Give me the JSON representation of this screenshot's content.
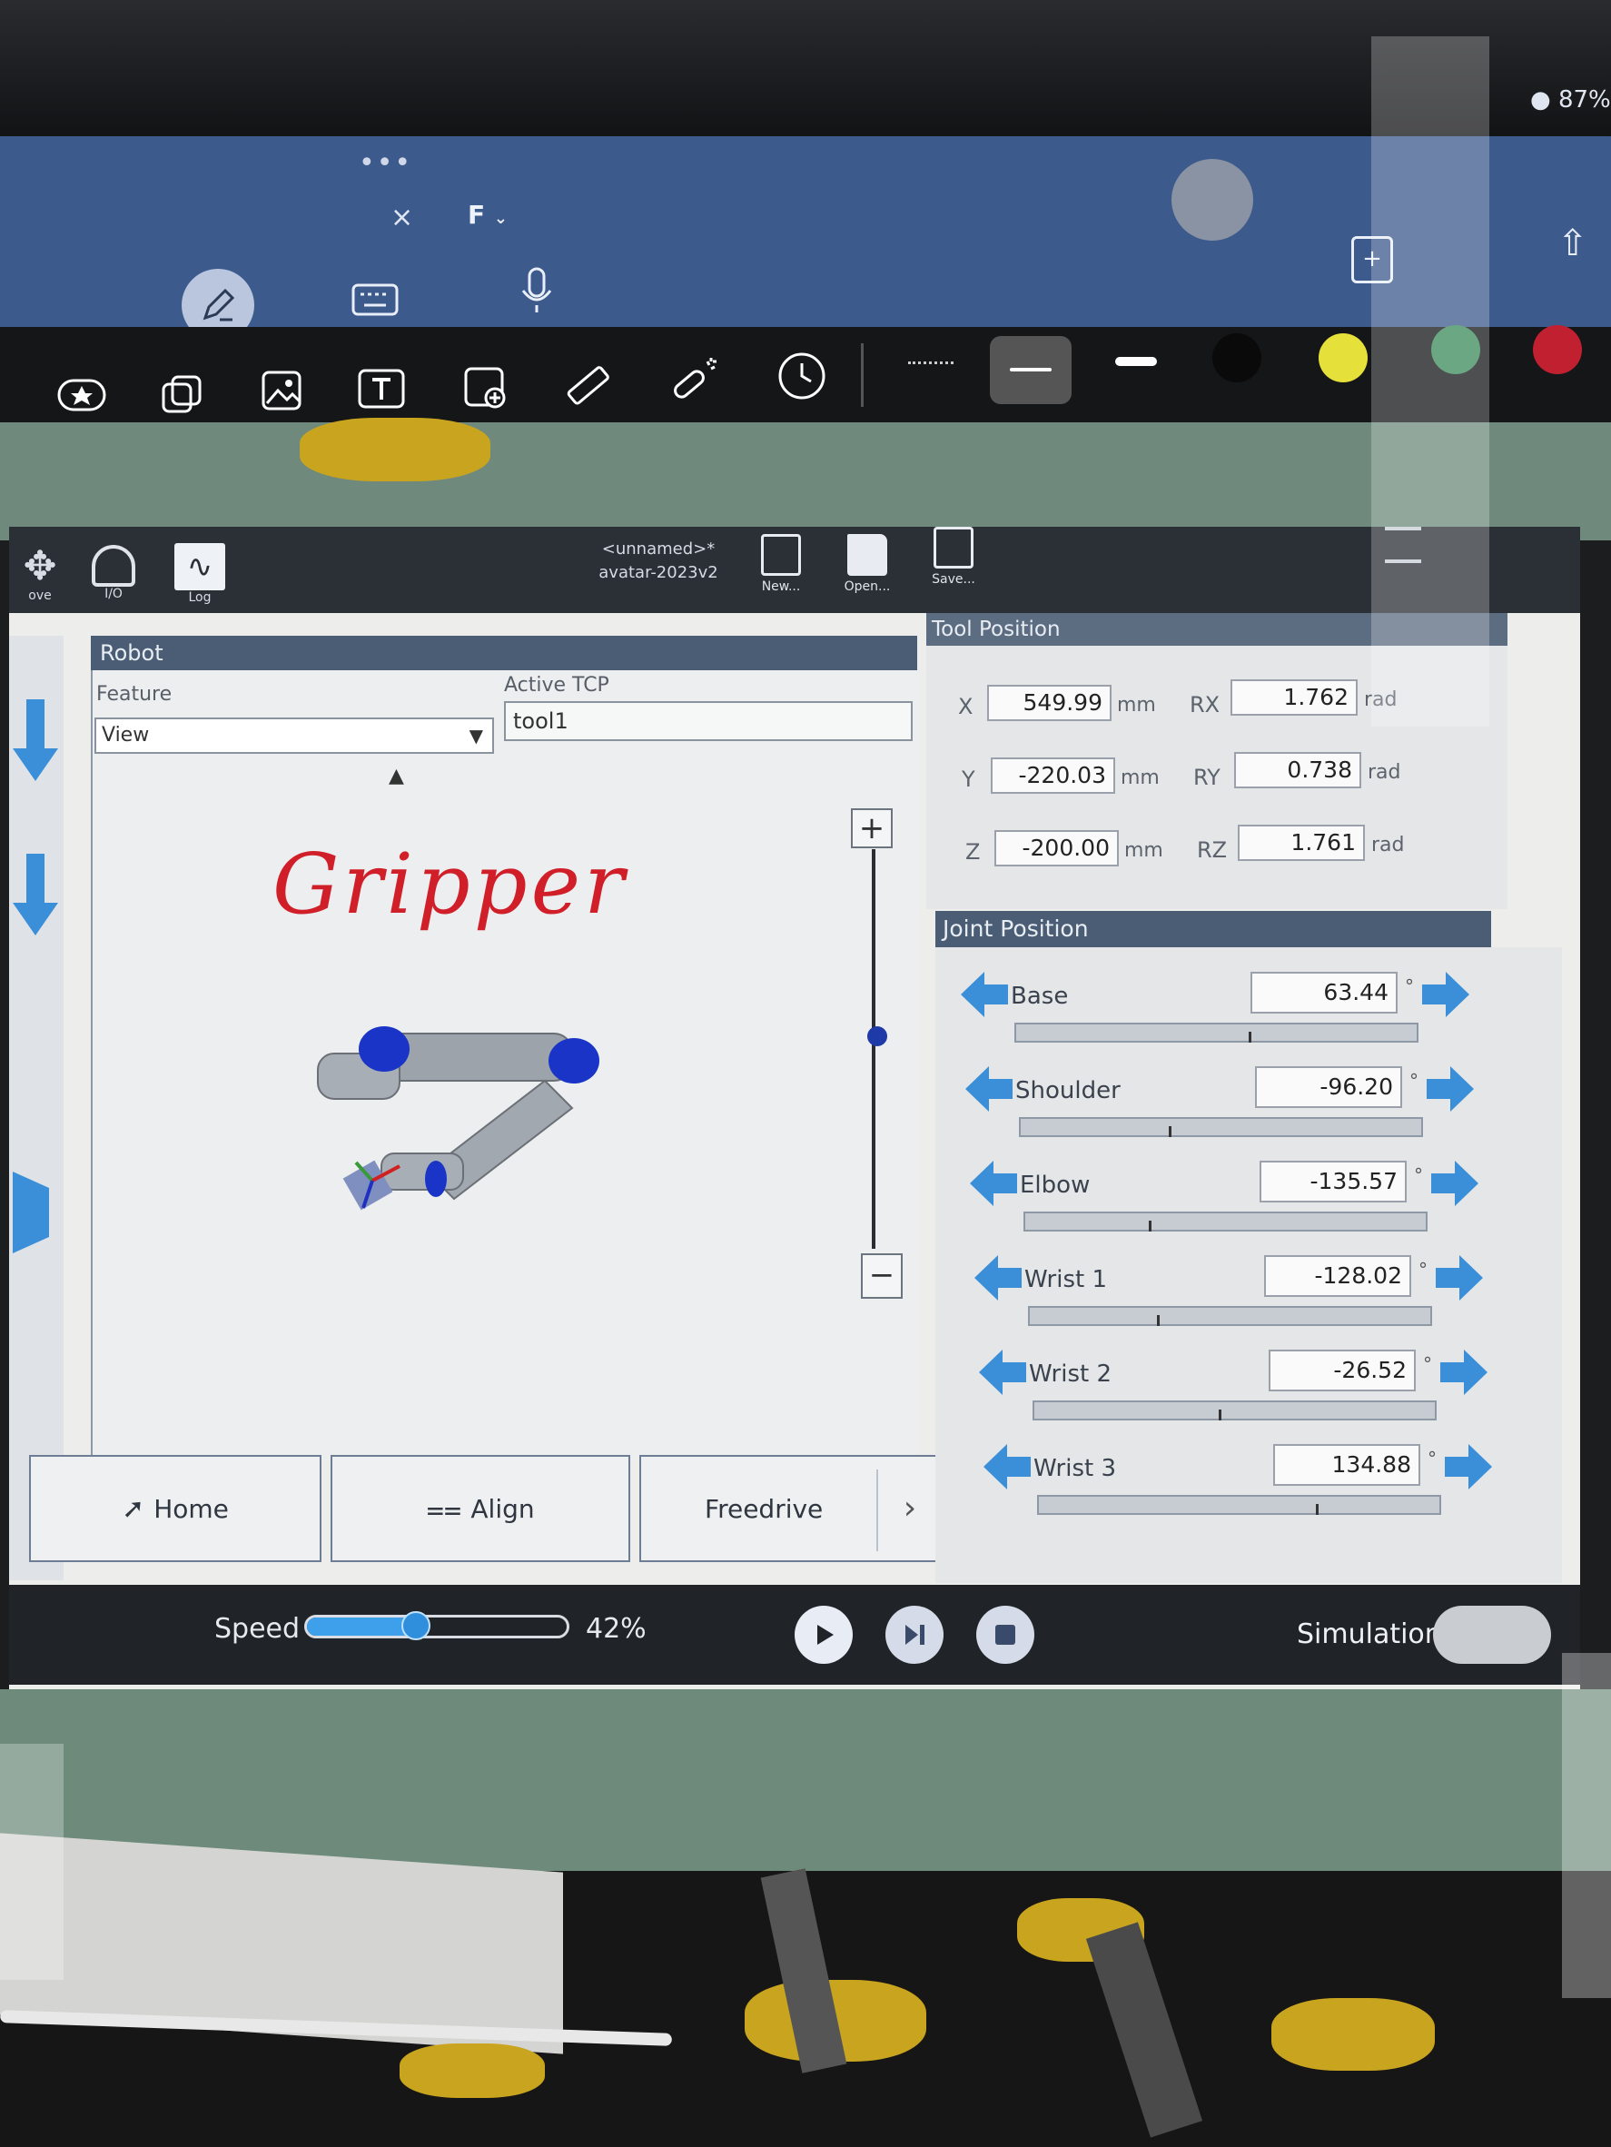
{
  "ipad": {
    "dots": "•••",
    "close": "×",
    "folder": "F",
    "battery": "87%"
  },
  "polyscope": {
    "header": {
      "left_items": [
        {
          "label": "ove"
        },
        {
          "label": "I/O"
        },
        {
          "label": "Log"
        }
      ],
      "program_title": "<unnamed>*",
      "installation": "avatar-2023v2",
      "file_buttons": [
        {
          "label": "New..."
        },
        {
          "label": "Open..."
        },
        {
          "label": "Save..."
        }
      ]
    },
    "robot_panel": {
      "title": "Robot",
      "feature_label": "Feature",
      "feature_value": "View",
      "tcp_label": "Active TCP",
      "tcp_value": "tool1",
      "annotation": "Gripper",
      "zoom_plus": "+",
      "zoom_minus": "−",
      "buttons": {
        "home": "Home",
        "align": "Align",
        "freedrive": "Freedrive",
        "more": "›"
      }
    },
    "tool_position": {
      "title": "Tool Position",
      "rows": [
        {
          "axis": "X",
          "value": "549.99",
          "unit": "mm",
          "rot_axis": "RX",
          "rot_value": "1.762",
          "rot_unit": "rad"
        },
        {
          "axis": "Y",
          "value": "-220.03",
          "unit": "mm",
          "rot_axis": "RY",
          "rot_value": "0.738",
          "rot_unit": "rad"
        },
        {
          "axis": "Z",
          "value": "-200.00",
          "unit": "mm",
          "rot_axis": "RZ",
          "rot_value": "1.761",
          "rot_unit": "rad"
        }
      ]
    },
    "joint_position": {
      "title": "Joint Position",
      "unit": "°",
      "joints": [
        {
          "name": "Base",
          "value": "63.44",
          "level": 0.58
        },
        {
          "name": "Shoulder",
          "value": "-96.20",
          "level": 0.37
        },
        {
          "name": "Elbow",
          "value": "-135.57",
          "level": 0.31
        },
        {
          "name": "Wrist 1",
          "value": "-128.02",
          "level": 0.32
        },
        {
          "name": "Wrist 2",
          "value": "-26.52",
          "level": 0.46
        },
        {
          "name": "Wrist 3",
          "value": "134.88",
          "level": 0.69
        }
      ]
    },
    "footer": {
      "speed_label": "Speed",
      "speed_value": "42%",
      "speed_level": 0.42,
      "simulation_label": "Simulation"
    }
  },
  "colors": {
    "accent": "#3ea0ea",
    "panel_header": "#4b5d74",
    "annotation": "#d11f2a"
  }
}
